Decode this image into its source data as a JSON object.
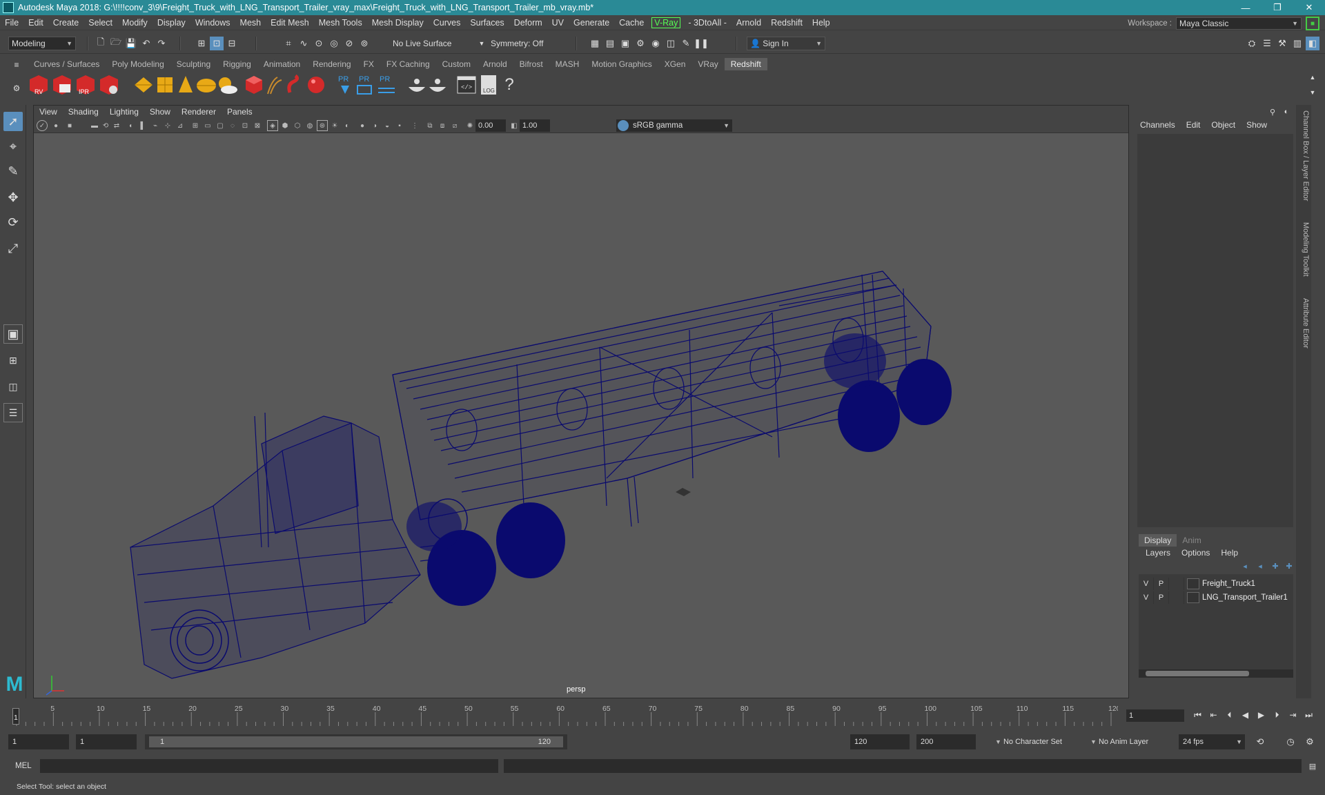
{
  "titlebar": {
    "title": "Autodesk Maya 2018: G:\\!!!!conv_3\\9\\Freight_Truck_with_LNG_Transport_Trailer_vray_max\\Freight_Truck_with_LNG_Transport_Trailer_mb_vray.mb*",
    "minimize": "—",
    "maximize": "❐",
    "close": "✕"
  },
  "menubar": {
    "items": [
      "File",
      "Edit",
      "Create",
      "Select",
      "Modify",
      "Display",
      "Windows",
      "Mesh",
      "Edit Mesh",
      "Mesh Tools",
      "Mesh Display",
      "Curves",
      "Surfaces",
      "Deform",
      "UV",
      "Generate",
      "Cache",
      "V-Ray",
      "- 3DtoAll -",
      "Arnold",
      "Redshift",
      "Help"
    ]
  },
  "workspace": {
    "label": "Workspace :",
    "value": "Maya Classic"
  },
  "statusline": {
    "mode": "Modeling",
    "live_surface": "No Live Surface",
    "symmetry": "Symmetry: Off",
    "sign_in": "Sign In"
  },
  "shelf": {
    "tabs": [
      "Curves / Surfaces",
      "Poly Modeling",
      "Sculpting",
      "Rigging",
      "Animation",
      "Rendering",
      "FX",
      "FX Caching",
      "Custom",
      "Arnold",
      "Bifrost",
      "MASH",
      "Motion Graphics",
      "XGen",
      "VRay",
      "Redshift"
    ],
    "active_tab": "Redshift",
    "icon_labels": {
      "rv": "RV",
      "ipr": "IPR",
      "pr": "PR",
      "log": "LOG",
      "help": "?"
    }
  },
  "viewport": {
    "menu": [
      "View",
      "Shading",
      "Lighting",
      "Show",
      "Renderer",
      "Panels"
    ],
    "exposure": "0.00",
    "gamma_value": "1.00",
    "color_space": "sRGB gamma",
    "camera": "persp",
    "wire_color": "#0a0a6e",
    "background_color": "#595959"
  },
  "channelbox": {
    "tabs": [
      "Channels",
      "Edit",
      "Object",
      "Show"
    ],
    "side_labels": [
      "Channel Box / Layer Editor",
      "Modeling Toolkit",
      "Attribute Editor"
    ]
  },
  "layers": {
    "tabs": [
      "Display",
      "Anim"
    ],
    "active_tab": "Display",
    "menu": [
      "Layers",
      "Options",
      "Help"
    ],
    "rows": [
      {
        "v": "V",
        "p": "P",
        "name": "Freight_Truck1"
      },
      {
        "v": "V",
        "p": "P",
        "name": "LNG_Transport_Trailer1"
      }
    ]
  },
  "timeline": {
    "ticks": [
      "5",
      "10",
      "15",
      "20",
      "25",
      "30",
      "35",
      "40",
      "45",
      "50",
      "55",
      "60",
      "65",
      "70",
      "75",
      "80",
      "85",
      "90",
      "95",
      "100",
      "105",
      "110",
      "115",
      "120"
    ],
    "start_mark": "1",
    "current_frame": "1"
  },
  "range": {
    "start": "1",
    "anim_start": "1",
    "range_low": "1",
    "range_high": "120",
    "playback_end": "120",
    "anim_end": "200",
    "character_set": "No Character Set",
    "anim_layer": "No Anim Layer",
    "fps": "24 fps"
  },
  "cmdline": {
    "label": "MEL"
  },
  "helpline": {
    "text": "Select Tool: select an object"
  },
  "logo": "M"
}
